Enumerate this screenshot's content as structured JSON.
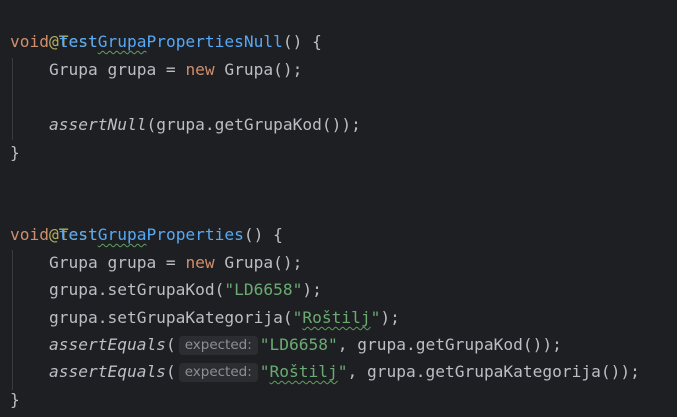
{
  "code": {
    "annotation": "@Test",
    "kw_void": "void",
    "kw_new": "new",
    "method1": {
      "prefix": "test",
      "typo_word": "Grupa",
      "suffix": "PropertiesNull",
      "signature_end": "() {"
    },
    "method2": {
      "prefix": "test",
      "typo_word": "Grupa",
      "suffix": "Properties",
      "signature_end": "() {"
    },
    "decl_lead": "Grupa grupa = ",
    "decl_tail": " Grupa();",
    "assert_null": "assertNull",
    "assert_null_args": "(grupa.getGrupaKod());",
    "close_brace": "}",
    "set_kod_call": "grupa.setGrupaKod(",
    "set_kod_value": "\"LD6658\"",
    "set_kat_call": "grupa.setGrupaKategorija(",
    "set_kat_quote_open": "\"",
    "set_kat_word": "Roštilj",
    "set_kat_quote_close": "\"",
    "call_end": ");",
    "assert_equals": "assertEquals",
    "open_paren": "(",
    "hint_label": "expected:",
    "assert_eq1_value": "\"LD6658\"",
    "assert_eq1_rest": ", grupa.getGrupaKod());",
    "assert_eq2_quote_open": "\"",
    "assert_eq2_word": "Roštilj",
    "assert_eq2_quote_close": "\"",
    "assert_eq2_rest": ", grupa.getGrupaKategorija());"
  },
  "colors": {
    "background": "#1e1f22",
    "default_text": "#bcbec4",
    "keyword": "#cf8e6d",
    "annotation": "#b3ae60",
    "method_declaration": "#56a8f5",
    "string": "#6aab73",
    "inlay_hint_bg": "#2b2d30",
    "inlay_hint_text": "#8c8f96"
  }
}
